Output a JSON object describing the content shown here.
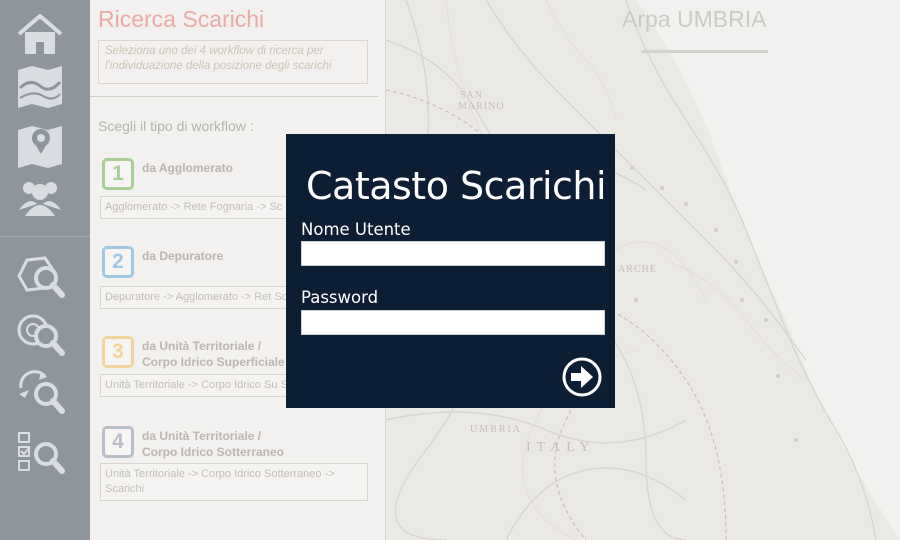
{
  "sidebar": {
    "items": [
      {
        "icon": "home-icon"
      },
      {
        "icon": "map-icon"
      },
      {
        "icon": "map-pin-icon"
      },
      {
        "icon": "users-icon"
      },
      {
        "icon": "search-area-icon"
      },
      {
        "icon": "search-disc-icon"
      },
      {
        "icon": "search-refresh-icon"
      },
      {
        "icon": "search-checklist-icon"
      }
    ]
  },
  "panel": {
    "title": "Ricerca Scarichi",
    "description": "Seleziona uno dei 4 workflow di ricerca per l'individuazione della posizione degli scarichi",
    "subtitle": "Scegli il tipo di workflow :",
    "workflows": [
      {
        "number": "1",
        "label_line1": "da Agglomerato",
        "label_line2": "",
        "path": "Agglomerato -> Rete Fognaria -> Sc",
        "color": "#a9cf98"
      },
      {
        "number": "2",
        "label_line1": "da Depuratore",
        "label_line2": "",
        "path": "Depuratore -> Agglomerato -> Ret Scarichi",
        "color": "#9fc9e0"
      },
      {
        "number": "3",
        "label_line1": "da Unità Territoriale /",
        "label_line2": "Corpo Idrico Superficiale",
        "path": "Unità Territoriale -> Corpo Idrico Su Scarichi",
        "color": "#f3d59b"
      },
      {
        "number": "4",
        "label_line1": "da Unità Territoriale /",
        "label_line2": "Corpo Idrico Sotterraneo",
        "path": "Unità Territoriale -> Corpo Idrico Sotterraneo -> Scarichi",
        "color": "#b9bfc8"
      }
    ]
  },
  "map": {
    "brand": "Arpa UMBRIA",
    "labels": {
      "san_marino_1": "SAN",
      "san_marino_2": "MARINO",
      "marche": "ARCHE",
      "umbria": "UMBRIA",
      "italy": "ITALY"
    }
  },
  "login": {
    "title": "Catasto Scarichi",
    "username_label": "Nome Utente",
    "username_value": "",
    "password_label": "Password",
    "password_value": "",
    "submit_icon": "arrow-right-circle-icon"
  },
  "colors": {
    "sidebar_bg": "#8e959d",
    "panel_title": "#ebaaa5",
    "login_bg": "#0d1d33"
  }
}
